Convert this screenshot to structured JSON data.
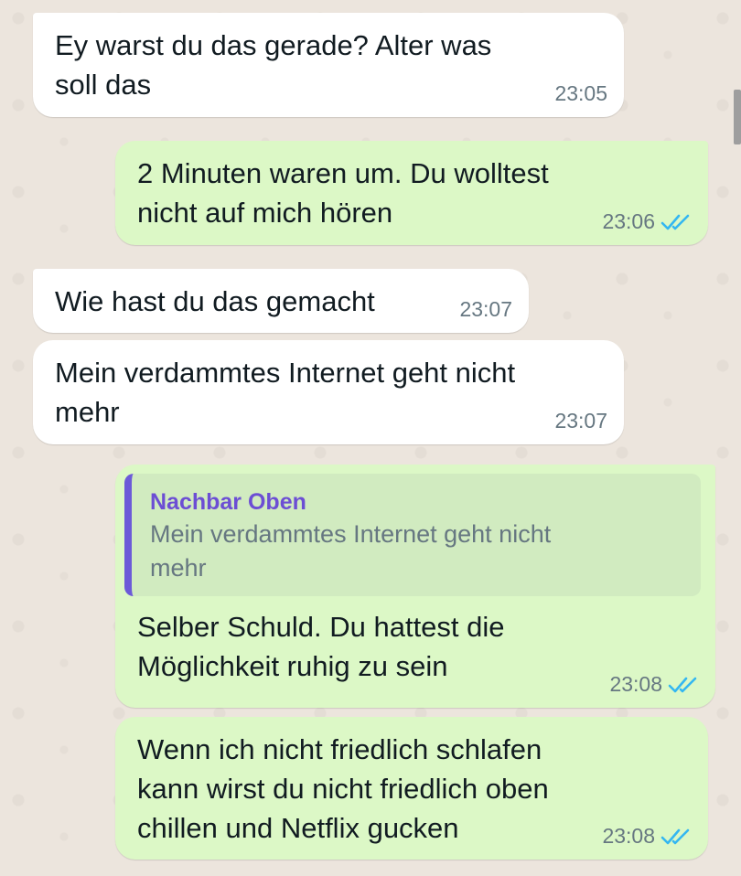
{
  "chat": {
    "messages": [
      {
        "direction": "in",
        "text": "Ey warst du das gerade? Alter was\nsoll das",
        "time": "23:05"
      },
      {
        "direction": "out",
        "text": "2 Minuten waren um. Du wolltest\nnicht auf mich hören",
        "time": "23:06",
        "status": "read"
      },
      {
        "direction": "in",
        "text": "Wie hast du das gemacht",
        "time": "23:07"
      },
      {
        "direction": "in",
        "text": "Mein verdammtes Internet geht nicht\nmehr",
        "time": "23:07"
      },
      {
        "direction": "out",
        "quote": {
          "author": "Nachbar Oben",
          "text": "Mein verdammtes Internet geht nicht\nmehr"
        },
        "text": "Selber Schuld. Du hattest die\nMöglichkeit ruhig zu sein",
        "time": "23:08",
        "status": "read"
      },
      {
        "direction": "out",
        "text": "Wenn ich nicht friedlich schlafen\nkann wirst du nicht friedlich oben\nchillen und Netflix gucken",
        "time": "23:08",
        "status": "read"
      }
    ]
  },
  "colors": {
    "incoming_bubble": "#FFFFFF",
    "outgoing_bubble": "#DCF8C6",
    "read_ticks": "#34B7F1",
    "quote_author": "#6C4ED4",
    "background": "#ECE5DD"
  },
  "icons": {
    "read_receipt": "double-check-icon"
  }
}
